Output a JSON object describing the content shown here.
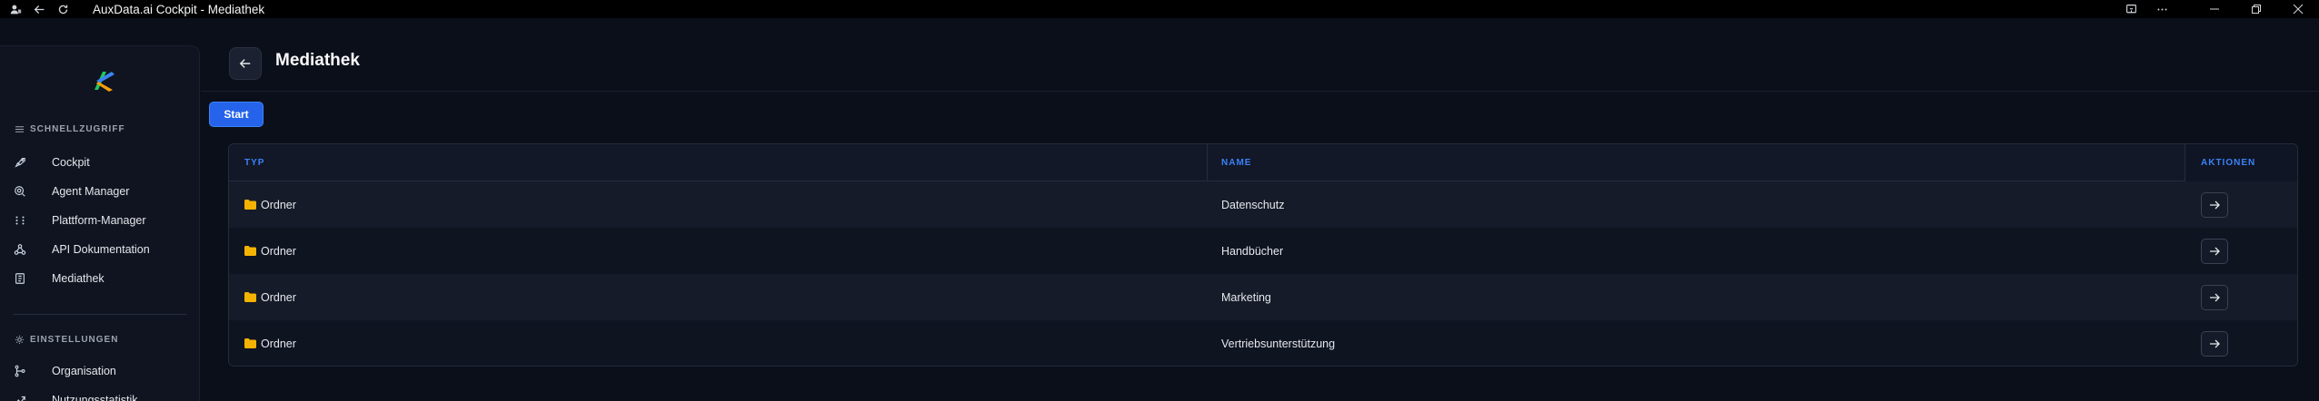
{
  "window": {
    "title": "AuxData.ai Cockpit - Mediathek"
  },
  "sidebar": {
    "sections": [
      {
        "title": "SCHNELLZUGRIFF",
        "items": [
          {
            "label": "Cockpit",
            "icon": "rocket-icon"
          },
          {
            "label": "Agent Manager",
            "icon": "agent-icon"
          },
          {
            "label": "Plattform-Manager",
            "icon": "grid-icon"
          },
          {
            "label": "API Dokumentation",
            "icon": "webhook-icon"
          },
          {
            "label": "Mediathek",
            "icon": "book-icon"
          }
        ]
      },
      {
        "title": "EINSTELLUNGEN",
        "items": [
          {
            "label": "Organisation",
            "icon": "org-icon"
          },
          {
            "label": "Nutzungsstatistik",
            "icon": "stats-icon"
          }
        ]
      }
    ]
  },
  "header": {
    "title": "Mediathek"
  },
  "toolbar": {
    "start_label": "Start"
  },
  "table": {
    "columns": {
      "type": "TYP",
      "name": "NAME",
      "actions": "AKTIONEN"
    },
    "rows": [
      {
        "type": "Ordner",
        "name": "Datenschutz"
      },
      {
        "type": "Ordner",
        "name": "Handbücher"
      },
      {
        "type": "Ordner",
        "name": "Marketing"
      },
      {
        "type": "Ordner",
        "name": "Vertriebsunterstützung"
      }
    ]
  },
  "colors": {
    "accent": "#2563eb",
    "header_text": "#3b82f6",
    "folder": "#f5b301",
    "background": "#0b0f1a"
  }
}
